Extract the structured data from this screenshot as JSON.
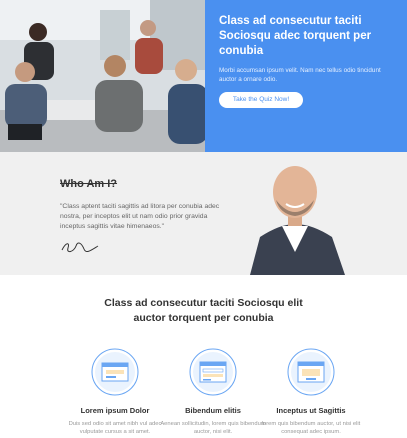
{
  "hero": {
    "title": "Class ad consecutur taciti Sociosqu adec torquent per conubia",
    "text": "Morbi accumsan ipsum velit. Nam nec tellus odio tincidunt auctor a ornare odio.",
    "button_label": "Take the Quiz Now!"
  },
  "about": {
    "title": "Who Am I?",
    "quote": "\"Class aptent taciti sagittis ad litora per conubia adec nostra, per inceptos elit ut  nam odio prior gravida inceptus sagittis vitae himenaeos.\"",
    "signature": "Signature"
  },
  "headline": {
    "line1": "Class ad consecutur taciti Sociosqu elit",
    "line2": "auctor torquent per conubia"
  },
  "features": [
    {
      "title": "Lorem ipsum Dolor",
      "text": "Duis sed odio sit amet nibh vul adec vulputate cursus a sit amet."
    },
    {
      "title": "Bibendum elitis",
      "text": "Aenean sollicitudin, lorem quis bibendum auctor, nisi elit."
    },
    {
      "title": "Inceptus ut Sagittis",
      "text": "lorem quis bibendum auctor, ut nisi elit consequat adec ipsum."
    }
  ],
  "colors": {
    "accent": "#4a90f0",
    "panel": "#f0f0f0",
    "icon": "#6aa6f3"
  }
}
